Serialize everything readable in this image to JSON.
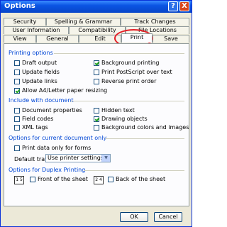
{
  "window": {
    "title": "Options",
    "help_label": "?",
    "close_label": "X"
  },
  "tabs_row1": [
    "Security",
    "Spelling & Grammar",
    "Track Changes"
  ],
  "tabs_row2": [
    "User Information",
    "Compatibility",
    "File Locations"
  ],
  "tabs_row3": [
    "View",
    "General",
    "Edit",
    "Print",
    "Save"
  ],
  "active_tab": "Print",
  "printing_options": {
    "heading": "Printing options",
    "left": [
      {
        "label": "Draft output",
        "checked": false
      },
      {
        "label": "Update fields",
        "checked": false
      },
      {
        "label": "Update links",
        "checked": false
      },
      {
        "label": "Allow A4/Letter paper resizing",
        "checked": true
      }
    ],
    "right": [
      {
        "label": "Background printing",
        "checked": true
      },
      {
        "label": "Print PostScript over text",
        "checked": false
      },
      {
        "label": "Reverse print order",
        "checked": false
      }
    ]
  },
  "include_with_document": {
    "heading": "Include with document",
    "left": [
      {
        "label": "Document properties",
        "checked": false
      },
      {
        "label": "Field codes",
        "checked": false
      },
      {
        "label": "XML tags",
        "checked": false
      }
    ],
    "right": [
      {
        "label": "Hidden text",
        "checked": false
      },
      {
        "label": "Drawing objects",
        "checked": true
      },
      {
        "label": "Background colors and images",
        "checked": false
      }
    ]
  },
  "current_document": {
    "heading": "Options for current document only",
    "print_data_only": {
      "label": "Print data only for forms",
      "checked": false
    },
    "default_tray_label": "Default tray:",
    "default_tray_value": "Use printer settings"
  },
  "duplex": {
    "heading": "Options for Duplex Printing",
    "front": {
      "label": "Front of the sheet",
      "checked": false,
      "icon": "1 5"
    },
    "back": {
      "label": "Back of the sheet",
      "checked": false,
      "icon": "2 4"
    }
  },
  "buttons": {
    "ok": "OK",
    "cancel": "Cancel"
  },
  "annotation_color": "#E41E26"
}
